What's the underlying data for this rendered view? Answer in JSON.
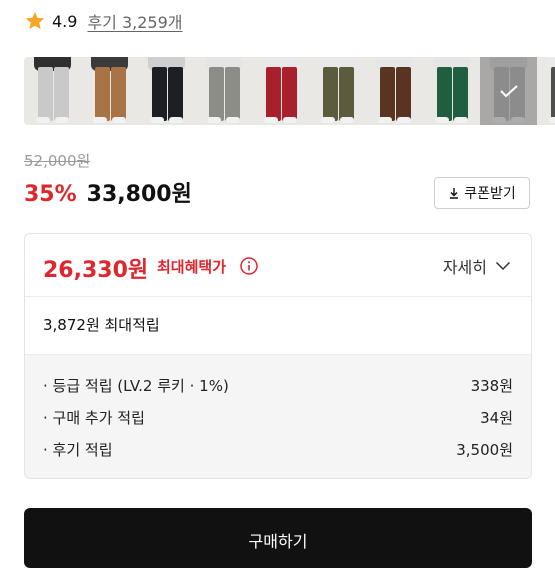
{
  "rating": {
    "score": "4.9",
    "review_link": "후기 3,259개",
    "star_color": "#f6a623"
  },
  "swatches": [
    {
      "name": "light-gray",
      "color": "#c9c9c9",
      "shirt": "#2f2f2f"
    },
    {
      "name": "camel",
      "color": "#a87445",
      "shirt": "#3b3b3b"
    },
    {
      "name": "black",
      "color": "#1e1f24",
      "shirt": "#cfcfcf"
    },
    {
      "name": "gray",
      "color": "#8d8d88",
      "shirt": "#e5e5e5"
    },
    {
      "name": "red",
      "color": "#a8202c",
      "shirt": "#e8e8e8"
    },
    {
      "name": "khaki",
      "color": "#5d5b3e",
      "shirt": "#e8e8e8"
    },
    {
      "name": "brown",
      "color": "#5a3422",
      "shirt": "#e6e6e6"
    },
    {
      "name": "green",
      "color": "#1f5f3f",
      "shirt": "#e5e5e5"
    },
    {
      "name": "melange-gray",
      "color": "#b5b5b5",
      "shirt": "#d8d8d8",
      "selected": true
    },
    {
      "name": "charcoal",
      "color": "#4e4e4e",
      "shirt": "#eaeaea"
    }
  ],
  "pricing": {
    "original": "52,000원",
    "discount": "35%",
    "price": "33,800원",
    "coupon_label": "쿠폰받기",
    "accent_color": "#e0262d"
  },
  "benefit": {
    "best_price": "26,330원",
    "best_label": "최대혜택가",
    "detail_label": "자세히",
    "max_points": "3,872원 최대적립",
    "rows": [
      {
        "label": "· 등급 적립 (LV.2 루키 · 1%)",
        "value": "338원"
      },
      {
        "label": "· 구매 추가 적립",
        "value": "34원"
      },
      {
        "label": "· 후기 적립",
        "value": "3,500원"
      }
    ]
  },
  "buy_button": {
    "label": "구매하기"
  }
}
